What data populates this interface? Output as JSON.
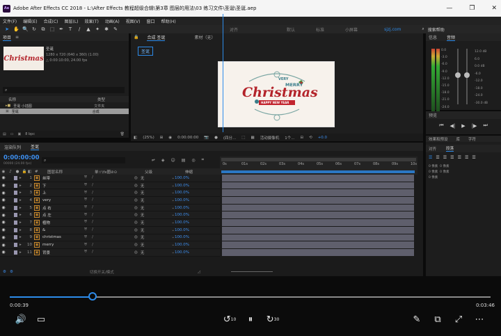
{
  "window": {
    "title": "Adobe After Effects CC 2018 - L:\\After Effects 教程超级合辑\\第3章 图层的用法\\03 练习文件\\圣诞\\圣诞.aep",
    "app_icon": "Ae",
    "controls": [
      "—",
      "❐",
      "✕"
    ]
  },
  "menu": [
    "文件(F)",
    "编辑(E)",
    "合成(C)",
    "图层(L)",
    "效果(T)",
    "动画(A)",
    "视图(V)",
    "窗口",
    "帮助(H)"
  ],
  "toolbar": {
    "tools": [
      "➤",
      "✋",
      "🔍",
      "↻",
      "⧉",
      "⬚",
      "✒",
      "T",
      "/",
      "▲",
      "✦",
      "✱",
      "✎"
    ],
    "align_label": "对齐",
    "workspaces": [
      "默认",
      "标准",
      "小屏幕"
    ],
    "site": "sjzj.com",
    "search_help": "搜索帮助"
  },
  "project": {
    "tab": "项目",
    "comp_name": "圣诞",
    "comp_size": "1280 x 720 (640 x 360) (1.00)",
    "comp_duration": "△ 0:00:10:00, 24.00 fps",
    "search_placeholder": "",
    "col_name": "名称",
    "col_type": "类型",
    "rows": [
      {
        "name": "圣诞 小插图",
        "type": "文件夹"
      },
      {
        "name": "圣诞",
        "type": "合成"
      }
    ],
    "footer_bpc": "8 bpc"
  },
  "viewer": {
    "tabs": [
      "合成",
      "圣诞"
    ],
    "layer_label": "素材（无）",
    "breadcrumb": "圣诞",
    "card": {
      "very": "VERY",
      "merry": "MERRY",
      "christmas": "Christmas",
      "banner": "HAPPY NEW YEAR"
    },
    "zoom": "(25%)",
    "timecode": "0:00:00:00",
    "resolution": "(四分...",
    "camera": "活动摄像机",
    "view_count": "1个...",
    "exposure": "+0.0"
  },
  "info_panel": {
    "tabs": [
      "信息",
      "音频"
    ],
    "db_labels": [
      "0.0",
      "-3.0",
      "-6.0",
      "-9.0",
      "-12.0",
      "-15.0",
      "-18.0",
      "-21.0",
      "-24.0"
    ],
    "db_right": [
      "12.0 dB",
      "6.0",
      "0.0 dB",
      "-6.0",
      "-12.0",
      "-18.0",
      "-24.0",
      "-30.0 dB"
    ]
  },
  "preview": {
    "tab": "预览",
    "buttons": [
      "⏮",
      "◀|",
      "▶",
      "|▶",
      "⏭"
    ]
  },
  "right_tabs": {
    "row1": [
      "效果和预设",
      "库",
      "字符"
    ],
    "row2": [
      "对齐",
      "段落"
    ]
  },
  "paragraph": {
    "values": [
      "0 像素",
      "0 像素",
      "0 像素",
      "0 像素",
      "0 像素"
    ]
  },
  "timeline": {
    "tabs": [
      "渲染队列",
      "圣诞"
    ],
    "timecode": "0:00:00:00",
    "timecode_sub": "00000 (24.00 fps)",
    "col_num": "#",
    "col_name": "图层名称",
    "col_switches": "单☆\\fx圈⊘⊙",
    "col_parent": "父级",
    "col_stretch": "伸缩",
    "ruler": [
      "0s",
      "01s",
      "02s",
      "03s",
      "04s",
      "05s",
      "06s",
      "07s",
      "08s",
      "09s",
      "10s"
    ],
    "layers": [
      {
        "num": "1",
        "name": "丝带",
        "parent": "无",
        "stretch": "100.0%"
      },
      {
        "num": "2",
        "name": "下",
        "parent": "无",
        "stretch": "100.0%"
      },
      {
        "num": "3",
        "name": "上",
        "parent": "无",
        "stretch": "100.0%"
      },
      {
        "num": "4",
        "name": "very",
        "parent": "无",
        "stretch": "100.0%"
      },
      {
        "num": "5",
        "name": "点 右",
        "parent": "无",
        "stretch": "100.0%"
      },
      {
        "num": "6",
        "name": "点 左",
        "parent": "无",
        "stretch": "100.0%"
      },
      {
        "num": "7",
        "name": "植物",
        "parent": "无",
        "stretch": "100.0%"
      },
      {
        "num": "8",
        "name": "&",
        "parent": "无",
        "stretch": "100.0%"
      },
      {
        "num": "9",
        "name": "christmas",
        "parent": "无",
        "stretch": "100.0%"
      },
      {
        "num": "10",
        "name": "merry",
        "parent": "无",
        "stretch": "100.0%"
      },
      {
        "num": "11",
        "name": "背景",
        "parent": "无",
        "stretch": "100.0%"
      }
    ],
    "footer_toggle": "切换开关/模式"
  },
  "player": {
    "current": "0:00:39",
    "total": "0:03:46",
    "progress": 0.1725,
    "icons": {
      "volume": "🔊",
      "subtitle": "▭",
      "back10": "↺",
      "pause": "⏸",
      "fwd30": "↻",
      "pen": "✎",
      "pip": "⧉",
      "expand": "⤢",
      "more": "⋯"
    },
    "back_label": "10",
    "fwd_label": "30"
  }
}
